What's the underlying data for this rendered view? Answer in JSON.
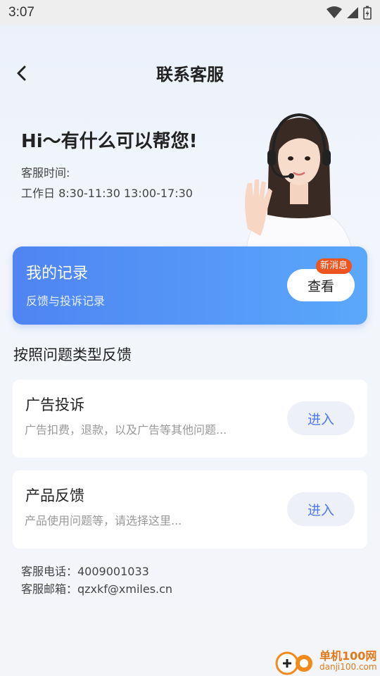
{
  "status_bar": {
    "time": "3:07"
  },
  "header": {
    "title": "联系客服"
  },
  "hero": {
    "greeting": "Hi～有什么可以帮您!",
    "hours_label": "客服时间:",
    "hours_value": "工作日 8:30-11:30 13:00-17:30"
  },
  "record_card": {
    "title": "我的记录",
    "subtitle": "反馈与投诉记录",
    "button_label": "查看",
    "badge": "新消息"
  },
  "section_title": "按照问题类型反馈",
  "feedback_items": [
    {
      "title": "广告投诉",
      "description": "广告扣费，退款，以及广告等其他问题...",
      "button_label": "进入"
    },
    {
      "title": "产品反馈",
      "description": "产品使用问题等，请选择这里...",
      "button_label": "进入"
    }
  ],
  "contact": {
    "phone": "客服电话：4009001033",
    "email": "客服邮箱：qzxkf@xmiles.cn"
  },
  "watermark": {
    "brand": "单机100网",
    "url": "danji100.com"
  },
  "colors": {
    "accent": "#4f84f2",
    "badge": "#f0541e",
    "enter_text": "#4f78ec"
  }
}
